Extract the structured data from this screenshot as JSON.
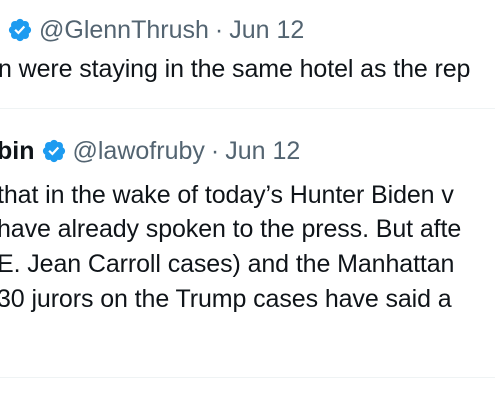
{
  "tweet1": {
    "handle": "@GlennThrush",
    "separator": "·",
    "date": "Jun 12",
    "text_line1": "n were staying in the same hotel as the rep"
  },
  "tweet2": {
    "name_partial": "bin",
    "handle": "@lawofruby",
    "separator": "·",
    "date": "Jun 12",
    "text_lines": [
      "that in the wake of today’s Hunter Biden v",
      "have already spoken to the press. But afte",
      "E. Jean Carroll cases) and the Manhattan",
      "30 jurors on the Trump cases have said a"
    ]
  },
  "colors": {
    "verified_blue": "#1d9bf0",
    "text_primary": "#0f1419",
    "text_secondary": "#536471",
    "divider": "#eff3f4"
  }
}
